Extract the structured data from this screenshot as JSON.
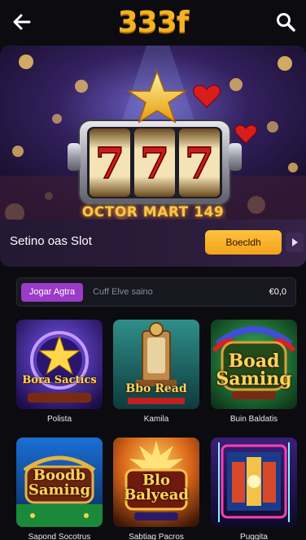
{
  "header": {
    "logo": "333f",
    "back_icon": "arrow-left-icon",
    "search_icon": "search-icon"
  },
  "banner": {
    "caption": "OCTOR MART 149",
    "title": "Setino oas Slot",
    "cta_label": "Boecldh",
    "next_icon": "play-triangle-icon"
  },
  "action_bar": {
    "play_label": "Jogar Agtra",
    "promo_text": "Cuff Elve saino",
    "balance": "€0,0"
  },
  "games": [
    {
      "label": "Polista",
      "art_title": "Bora Sactics",
      "theme": "#5a2fb0"
    },
    {
      "label": "Kamila",
      "art_title": "Bbo Read",
      "theme": "#2a7a78"
    },
    {
      "label": "Buin Baldatis",
      "art_title": "Boad Saming",
      "theme": "#1f6e3a"
    },
    {
      "label": "Sapond Socotrus",
      "art_title": "Boodb Saming",
      "theme": "#1f4fb0"
    },
    {
      "label": "Sabtiag Pacros",
      "art_title": "Blo Balyead",
      "theme": "#c7571a"
    },
    {
      "label": "Puggita",
      "art_title": "",
      "theme": "#2b1a52"
    }
  ],
  "colors": {
    "brand": "#f5b321",
    "accent": "#9b3bc7",
    "background": "#0b0b10"
  }
}
